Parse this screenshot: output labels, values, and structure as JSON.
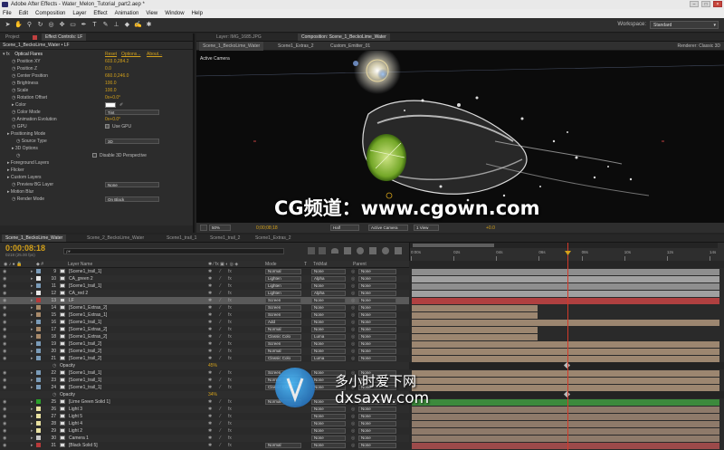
{
  "app": {
    "title": "Adobe After Effects - Water_Melon_Tutorial_part2.aep *"
  },
  "menu": [
    "File",
    "Edit",
    "Composition",
    "Layer",
    "Effect",
    "Animation",
    "View",
    "Window",
    "Help"
  ],
  "workspace": {
    "label": "Workspace:",
    "value": "Standard"
  },
  "left_tabs": {
    "project": "Project",
    "effect_controls": "Effect Controls: LF"
  },
  "effect_controls": {
    "header": "Scene_1_BeckoLime_Water • LF",
    "effect_name": "Optical Flares",
    "links": [
      "Reset",
      "Options...",
      "About..."
    ],
    "rows": [
      {
        "label": "Position XY",
        "value": "603.0,284.2",
        "indent": 2
      },
      {
        "label": "Position Z",
        "value": "0.0",
        "indent": 2
      },
      {
        "label": "Center Position",
        "value": "660.0,246.0",
        "indent": 2
      },
      {
        "label": "Brightness",
        "value": "100.0",
        "indent": 2
      },
      {
        "label": "Scale",
        "value": "100.0",
        "indent": 2
      },
      {
        "label": "Rotation Offset",
        "value": "0x+0.0°",
        "indent": 2
      },
      {
        "label": "Color",
        "value": "",
        "indent": 2,
        "swatch": true
      },
      {
        "label": "Color Mode",
        "drop": "Tint",
        "indent": 2
      },
      {
        "label": "Animation Evolution",
        "value": "0x+0.0°",
        "indent": 2
      },
      {
        "label": "GPU",
        "check": "Use GPU",
        "indent": 2
      },
      {
        "label": "Positioning Mode",
        "value": "",
        "indent": 1
      },
      {
        "label": "Source Type",
        "drop": "3D",
        "indent": 3
      },
      {
        "label": "3D Options",
        "value": "",
        "indent": 2
      },
      {
        "label": "",
        "check": "Disable 3D Perspective",
        "indent": 3
      },
      {
        "label": "Foreground Layers",
        "value": "",
        "indent": 1
      },
      {
        "label": "Flicker",
        "value": "",
        "indent": 1
      },
      {
        "label": "Custom Layers",
        "value": "",
        "indent": 1
      },
      {
        "label": "Preview BG Layer",
        "drop": "None",
        "indent": 2
      },
      {
        "label": "Motion Blur",
        "value": "",
        "indent": 1
      },
      {
        "label": "Render Mode",
        "drop": "On Black",
        "indent": 2
      }
    ]
  },
  "comp_tabs": {
    "layer": "Layer: IMG_1685.JPG",
    "composition": "Composition: Scene_1_BeckoLime_Water"
  },
  "comp_subtabs": [
    "Scene_1_BeckoLime_Water",
    "Scene1_Extras_2",
    "Custom_Emitter_01"
  ],
  "renderer": "Renderer:  Classic 3D",
  "view_label": "Active Camera",
  "viewer_bar": {
    "zoom": "50%",
    "time": "0;00;08;18",
    "resolution": "Half",
    "camera": "Active Camera",
    "views": "1 View",
    "exposure": "+0.0"
  },
  "watermark": {
    "main": "CG频道：www.cgown.com",
    "site_cn": "多小时爱下网",
    "site_url": "dxsaxw.com"
  },
  "timeline_tabs": [
    "Scene_1_BeckoLime_Water",
    "Scene_2_BeckoLime_Water",
    "Scene1_trail_1",
    "Scene1_trail_2",
    "Scene1_Extras_2"
  ],
  "timecode": "0:00:08:18",
  "timecode_sub": "0218 (25.00 fps)",
  "search_placeholder": "ρ▾",
  "columns": {
    "layer_name": "Layer Name",
    "mode": "Mode",
    "t": "T",
    "trkmat": "TrkMat",
    "parent": "Parent"
  },
  "ruler": [
    "0:00s",
    "02s",
    "04s",
    "06s",
    "08s",
    "10s",
    "12s",
    "14s"
  ],
  "layers": [
    {
      "num": "9",
      "name": "[Scene1_trail_1]",
      "color": "#7a9bb8",
      "mode": "Normal",
      "trk": "None",
      "bar": "#8e8e8e",
      "bar_end": 1.0
    },
    {
      "num": "10",
      "name": "CA_green 2",
      "color": "#e8e8e8",
      "mode": "Lighten",
      "trk": "Alpha",
      "bar": "#a0a0a0",
      "bar_end": 1.0
    },
    {
      "num": "11",
      "name": "[Scene1_trail_1]",
      "color": "#7a9bb8",
      "mode": "Lighten",
      "trk": "None",
      "bar": "#8e8e8e",
      "bar_end": 1.0
    },
    {
      "num": "12",
      "name": "CA_red 2",
      "color": "#e8e8e8",
      "mode": "Lighten",
      "trk": "Alpha",
      "bar": "#a0a0a0",
      "bar_end": 1.0
    },
    {
      "num": "13",
      "name": "LF",
      "color": "#b83a3a",
      "mode": "Screen",
      "trk": "None",
      "bar": "#b04040",
      "bar_end": 1.0,
      "selected": true
    },
    {
      "num": "14",
      "name": "[Scene1_Extras_2]",
      "color": "#a88a6a",
      "mode": "Screen",
      "trk": "None",
      "bar": "#9c8670",
      "bar_end": 0.41
    },
    {
      "num": "15",
      "name": "[Scene1_Extras_1]",
      "color": "#a88a6a",
      "mode": "Screen",
      "trk": "None",
      "bar": "#9c8670",
      "bar_end": 0.41
    },
    {
      "num": "16",
      "name": "[Scene1_trail_1]",
      "color": "#7a9bb8",
      "mode": "Add",
      "trk": "None",
      "bar": "#9c8670",
      "bar_end": 1.0
    },
    {
      "num": "17",
      "name": "[Scene1_Extras_2]",
      "color": "#a88a6a",
      "mode": "Normal",
      "trk": "None",
      "bar": "#9c8670",
      "bar_end": 0.41
    },
    {
      "num": "18",
      "name": "[Scene1_Extras_2]",
      "color": "#a88a6a",
      "mode": "Classic Colo",
      "trk": "Luma",
      "bar": "#9c8670",
      "bar_end": 0.41
    },
    {
      "num": "19",
      "name": "[Scene1_trail_2]",
      "color": "#7a9bb8",
      "mode": "Screen",
      "trk": "None",
      "bar": "#9c8670",
      "bar_end": 1.0
    },
    {
      "num": "20",
      "name": "[Scene1_trail_2]",
      "color": "#7a9bb8",
      "mode": "Normal",
      "trk": "None",
      "bar": "#9c8670",
      "bar_end": 1.0
    },
    {
      "num": "21",
      "name": "[Scene1_trail_2]",
      "color": "#7a9bb8",
      "mode": "Classic Colo",
      "trk": "Luma",
      "bar": "#9c8670",
      "bar_end": 1.0
    },
    {
      "num": "",
      "name": "Opacity",
      "sub": true,
      "value": "45%"
    },
    {
      "num": "22",
      "name": "[Scene1_trail_1]",
      "color": "#7a9bb8",
      "mode": "Screen",
      "trk": "None",
      "bar": "#9c8670",
      "bar_end": 1.0
    },
    {
      "num": "23",
      "name": "[Scene1_trail_1]",
      "color": "#7a9bb8",
      "mode": "Normal",
      "trk": "None",
      "bar": "#9c8670",
      "bar_end": 1.0
    },
    {
      "num": "24",
      "name": "[Scene1_trail_1]",
      "color": "#7a9bb8",
      "mode": "Classic Colo",
      "trk": "None",
      "bar": "#9c8670",
      "bar_end": 1.0
    },
    {
      "num": "",
      "name": "Opacity",
      "sub": true,
      "value": "34%"
    },
    {
      "num": "25",
      "name": "[Lime Green Solid 1]",
      "color": "#2aa02a",
      "mode": "Normal",
      "trk": "None",
      "bar": "#3c8a3c",
      "bar_end": 1.0
    },
    {
      "num": "26",
      "name": "Light 3",
      "color": "#e8e0a0",
      "mode": "",
      "trk": "None",
      "bar": "#8e7a6a",
      "bar_end": 1.0
    },
    {
      "num": "27",
      "name": "Light 5",
      "color": "#e8e0a0",
      "mode": "",
      "trk": "None",
      "bar": "#8e7a6a",
      "bar_end": 1.0
    },
    {
      "num": "28",
      "name": "Light 4",
      "color": "#e8e0a0",
      "mode": "",
      "trk": "None",
      "bar": "#8e7a6a",
      "bar_end": 1.0
    },
    {
      "num": "29",
      "name": "Light 2",
      "color": "#e8e0a0",
      "mode": "",
      "trk": "None",
      "bar": "#8e7a6a",
      "bar_end": 1.0
    },
    {
      "num": "30",
      "name": "Camera 1",
      "color": "#c8c8c8",
      "mode": "",
      "trk": "None",
      "bar": "#8e7a6a",
      "bar_end": 1.0
    },
    {
      "num": "31",
      "name": "[Black Solid 5]",
      "color": "#b83a3a",
      "mode": "Normal",
      "trk": "None",
      "bar": "#9c4a4a",
      "bar_end": 1.0
    }
  ],
  "colors": {
    "playhead": "#d23a2a",
    "accent": "#d4a11a"
  }
}
